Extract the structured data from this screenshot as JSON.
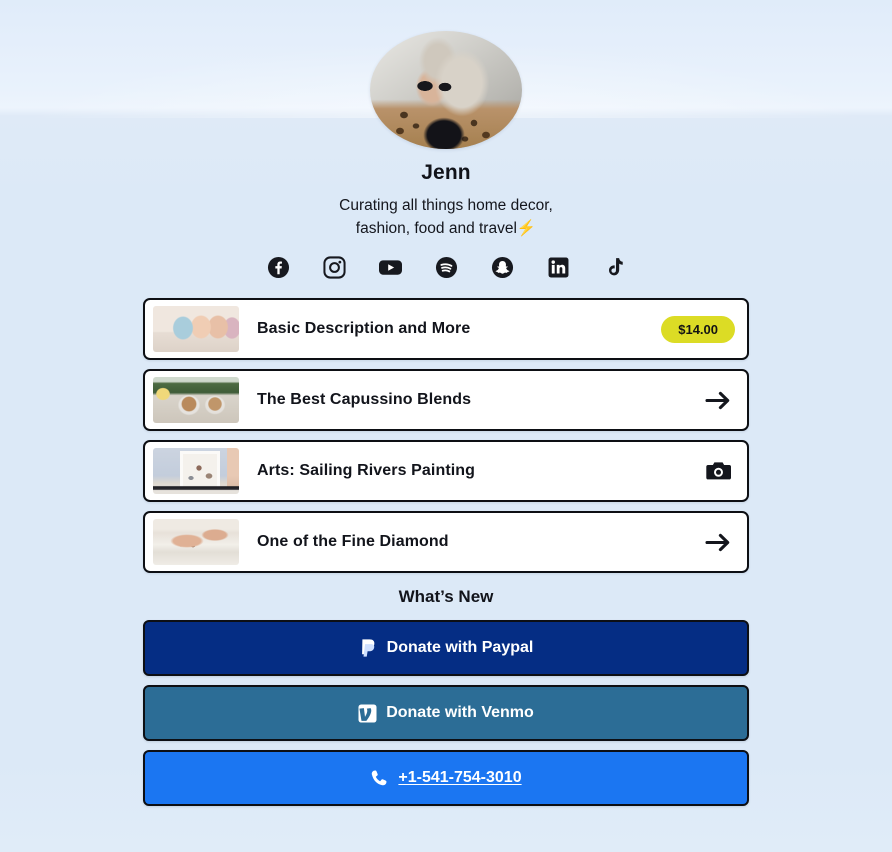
{
  "profile": {
    "avatar_alt": "avatar",
    "name": "Jenn",
    "bio_line1": "Curating all things home decor,",
    "bio_line2": "fashion, food and travel",
    "bio_emoji": "⚡"
  },
  "socials": [
    {
      "name": "facebook-icon",
      "label": "Facebook"
    },
    {
      "name": "instagram-icon",
      "label": "Instagram"
    },
    {
      "name": "youtube-icon",
      "label": "YouTube"
    },
    {
      "name": "spotify-icon",
      "label": "Spotify"
    },
    {
      "name": "snapchat-icon",
      "label": "Snapchat"
    },
    {
      "name": "linkedin-icon",
      "label": "LinkedIn"
    },
    {
      "name": "tiktok-icon",
      "label": "TikTok"
    }
  ],
  "cards": [
    {
      "title": "Basic Description and More",
      "thumb": "sofa-pillows-thumbnail",
      "action_type": "price",
      "price": "$14.00"
    },
    {
      "title": "The Best Capussino Blends",
      "thumb": "coffee-cups-thumbnail",
      "action_type": "arrow",
      "action_icon": "arrow-right-icon"
    },
    {
      "title": "Arts: Sailing Rivers Painting",
      "thumb": "framed-art-thumbnail",
      "action_type": "camera",
      "action_icon": "camera-icon"
    },
    {
      "title": "One of the Fine Diamond",
      "thumb": "hands-rings-thumbnail",
      "action_type": "arrow",
      "action_icon": "arrow-right-icon"
    }
  ],
  "section": {
    "whats_new": "What’s New"
  },
  "buttons": [
    {
      "label": "Donate with Paypal",
      "icon": "paypal-icon",
      "color": "#052d84"
    },
    {
      "label": "Donate with Venmo",
      "icon": "venmo-icon",
      "color": "#2c6d96"
    },
    {
      "label": "+1-541-754-3010",
      "icon": "phone-icon",
      "color": "#1b76f2"
    }
  ],
  "colors": {
    "page_background": "#dce9f7",
    "card_background": "#ffffff",
    "card_border": "#0d0f14",
    "price_badge": "#dcdc25",
    "text": "#12141b"
  }
}
